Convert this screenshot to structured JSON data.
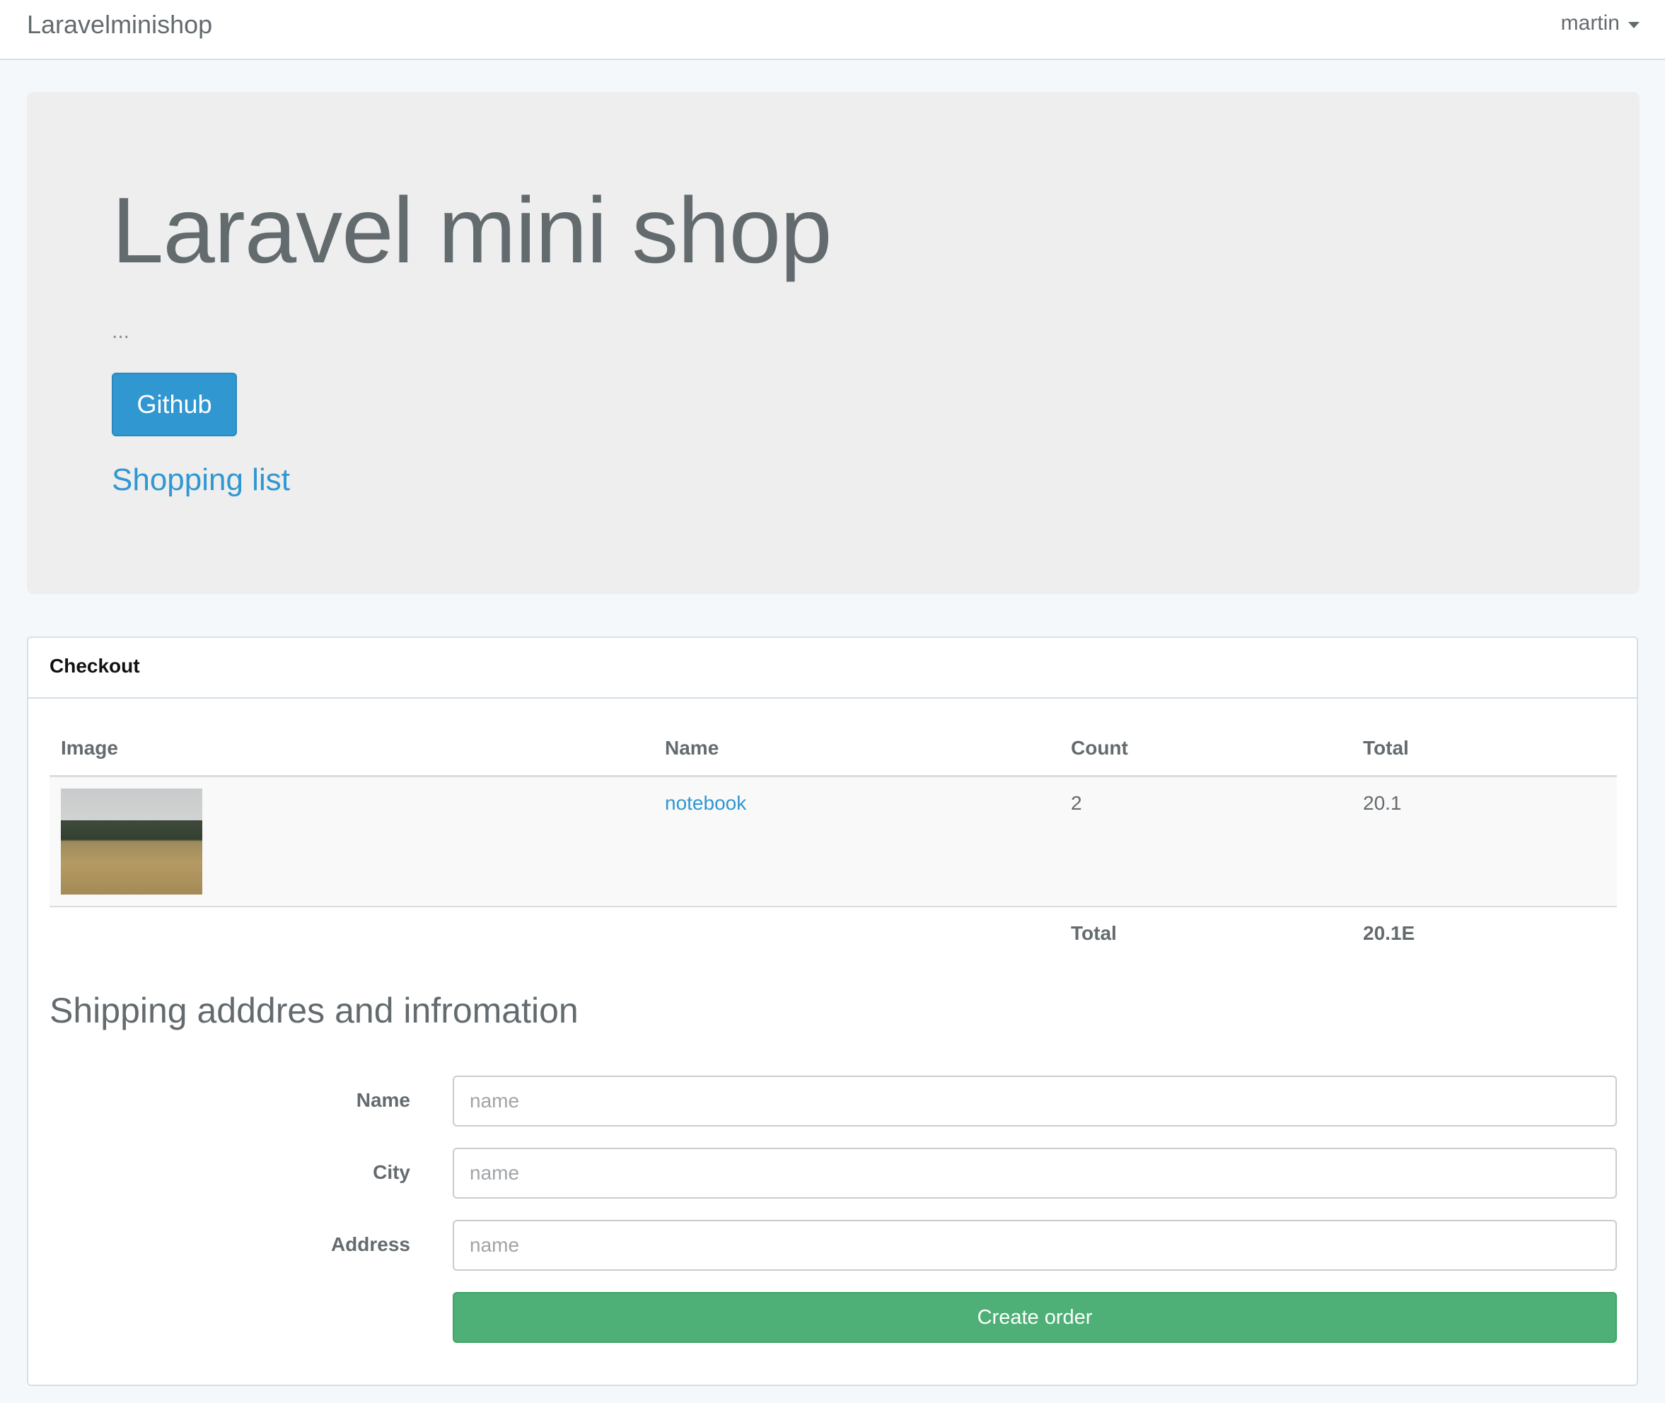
{
  "navbar": {
    "brand": "Laravelminishop",
    "user": "martin"
  },
  "jumbotron": {
    "title": "Laravel mini shop",
    "subtitle": "...",
    "github_label": "Github",
    "shopping_list_label": "Shopping list"
  },
  "checkout": {
    "heading": "Checkout",
    "columns": [
      "Image",
      "Name",
      "Count",
      "Total"
    ],
    "rows": [
      {
        "name": "notebook",
        "count": "2",
        "total": "20.1"
      }
    ],
    "total_label": "Total",
    "total_value": "20.1E"
  },
  "shipping": {
    "title": "Shipping adddres and infromation",
    "fields": [
      {
        "label": "Name",
        "placeholder": "name"
      },
      {
        "label": "City",
        "placeholder": "name"
      },
      {
        "label": "Address",
        "placeholder": "name"
      }
    ],
    "submit_label": "Create order"
  },
  "colors": {
    "primary": "#3097d1",
    "success": "#4eb076",
    "jumbotron_bg": "#eeeeee",
    "page_bg": "#f5f8fa"
  }
}
